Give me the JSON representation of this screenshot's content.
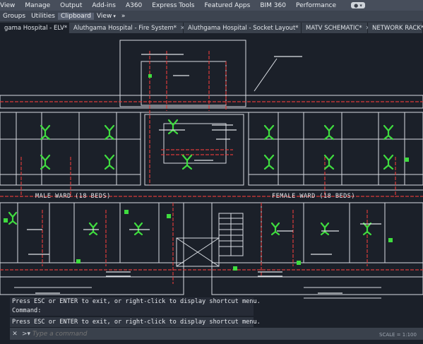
{
  "menu": {
    "items": [
      "View",
      "Manage",
      "Output",
      "Add-ins",
      "A360",
      "Express Tools",
      "Featured Apps",
      "BIM 360",
      "Performance"
    ],
    "extra": "● ▾"
  },
  "panels": {
    "items": [
      "Groups",
      "Utilities",
      "Clipboard",
      "View"
    ],
    "arrow": "▾",
    "overflow": "»"
  },
  "tabs": [
    {
      "label": "Aluthgama Hospital - ELV*",
      "shown": "gama Hospital - ELV*"
    },
    {
      "label": "Aluthgama Hospital - Fire System*"
    },
    {
      "label": "Aluthgama Hospital - Socket Layout*"
    },
    {
      "label": "MATV SCHEMATIC*"
    },
    {
      "label": "NETWORK RACK*"
    }
  ],
  "drawing": {
    "ward_left": "MALE WARD (18 BEDS)",
    "ward_right": "FEMALE WARD (18 BEDS)"
  },
  "command": {
    "history": [
      "Press ESC or ENTER to exit, or right-click to display shortcut menu.",
      "Command:"
    ],
    "last": "Press ESC or ENTER to exit, or right-click to display shortcut menu.",
    "placeholder": "Type a command"
  },
  "status": {
    "scale": "SCALE = 1:100"
  },
  "colors": {
    "cad_background": "#1b2029",
    "circuit_red": "#d93a3a",
    "fixture_green": "#3fdc3f",
    "wall_white": "#d8dce2"
  }
}
